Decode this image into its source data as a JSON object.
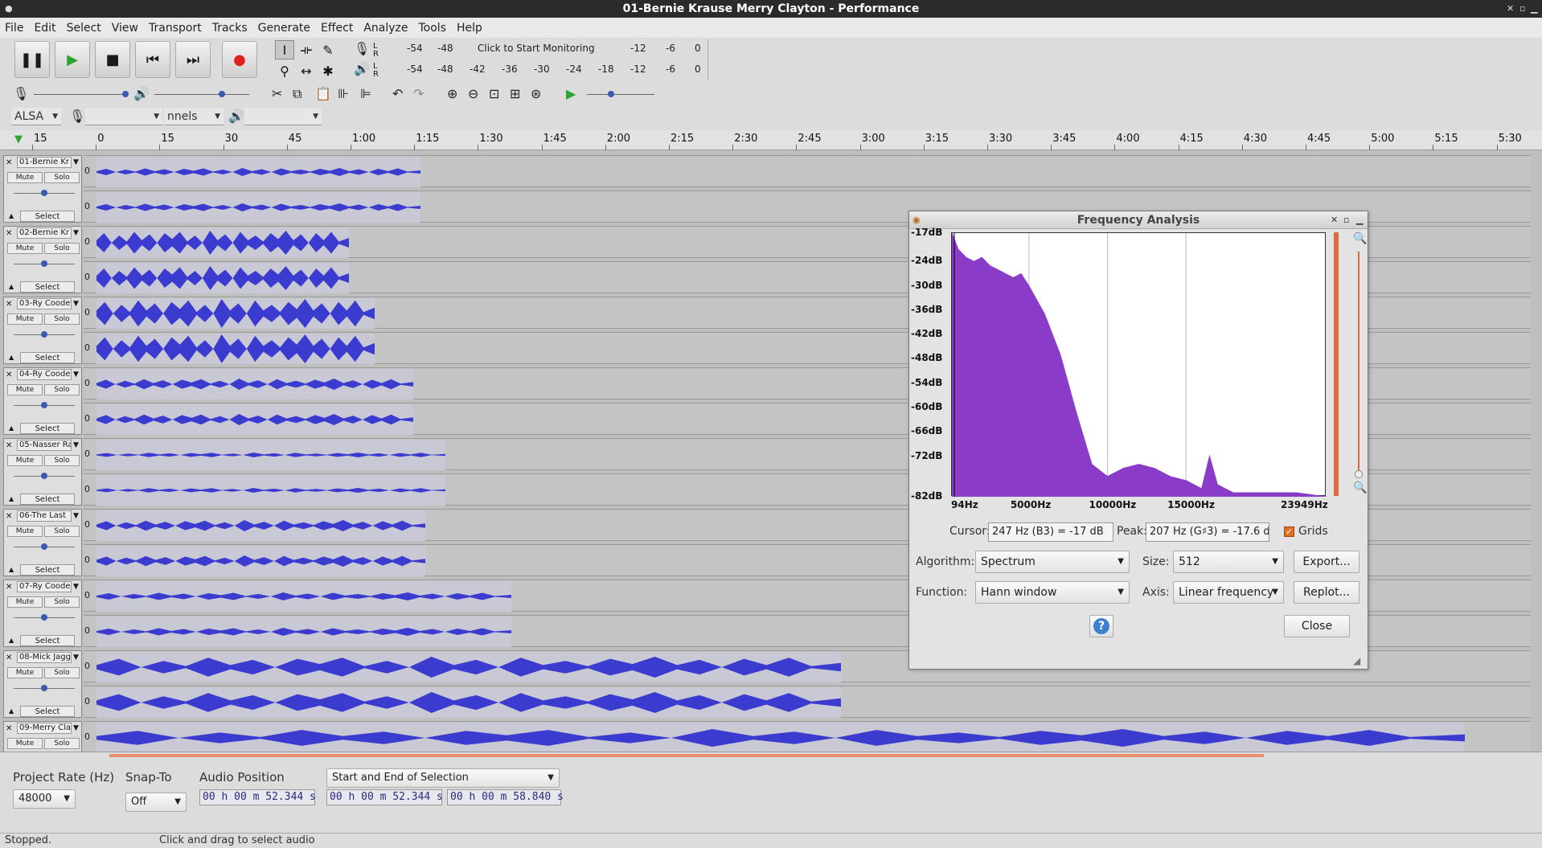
{
  "window": {
    "title": "01-Bernie Krause Merry Clayton - Performance"
  },
  "menu": [
    "File",
    "Edit",
    "Select",
    "View",
    "Transport",
    "Tracks",
    "Generate",
    "Effect",
    "Analyze",
    "Tools",
    "Help"
  ],
  "meter": {
    "record_scale": [
      "-54",
      "-48",
      "Click to Start Monitoring",
      "-12",
      "-6",
      "0"
    ],
    "play_scale": [
      "-54",
      "-48",
      "-42",
      "-36",
      "-30",
      "-24",
      "-18",
      "-12",
      "-6",
      "0"
    ],
    "lr": [
      "L",
      "R"
    ]
  },
  "device": {
    "host": "ALSA",
    "channels": "nnels"
  },
  "ruler": [
    "15",
    "0",
    "15",
    "30",
    "45",
    "1:00",
    "1:15",
    "1:30",
    "1:45",
    "2:00",
    "2:15",
    "2:30",
    "2:45",
    "3:00",
    "3:15",
    "3:30",
    "3:45",
    "4:00",
    "4:15",
    "4:30",
    "4:45",
    "5:00",
    "5:15",
    "5:30"
  ],
  "track_buttons": {
    "mute": "Mute",
    "solo": "Solo",
    "select": "Select",
    "zero": "0"
  },
  "tracks": [
    {
      "name": "01-Bernie Kr",
      "length": 0.225
    },
    {
      "name": "02-Bernie Kr",
      "length": 0.175
    },
    {
      "name": "03-Ry Coode",
      "length": 0.193
    },
    {
      "name": "04-Ry Coode",
      "length": 0.22
    },
    {
      "name": "05-Nasser Ra",
      "length": 0.242
    },
    {
      "name": "06-The Last",
      "length": 0.228
    },
    {
      "name": "07-Ry Coode",
      "length": 0.288
    },
    {
      "name": "08-Mick Jagg",
      "length": 0.517
    },
    {
      "name": "09-Merry Cla",
      "length": 0.95
    }
  ],
  "dialog": {
    "title": "Frequency Analysis",
    "db_labels": [
      "-17dB",
      "-24dB",
      "-30dB",
      "-36dB",
      "-42dB",
      "-48dB",
      "-54dB",
      "-60dB",
      "-66dB",
      "-72dB",
      "-82dB"
    ],
    "hz_labels": [
      "94Hz",
      "5000Hz",
      "10000Hz",
      "15000Hz",
      "23949Hz"
    ],
    "cursor_label": "Cursor:",
    "cursor_value": "247 Hz (B3) = -17 dB",
    "peak_label": "Peak:",
    "peak_value": "207 Hz (G♯3) = -17.6 d",
    "grids_label": "Grids",
    "grids_checked": true,
    "algorithm_label": "Algorithm:",
    "algorithm": "Spectrum",
    "size_label": "Size:",
    "size": "512",
    "function_label": "Function:",
    "function": "Hann window",
    "axis_label": "Axis:",
    "axis": "Linear frequency",
    "export": "Export...",
    "replot": "Replot...",
    "help": "?",
    "close": "Close"
  },
  "chart_data": {
    "type": "area",
    "xlabel": "",
    "ylabel": "",
    "xlim": [
      94,
      23949
    ],
    "ylim": [
      -82,
      -17
    ],
    "x_ticks": [
      "94Hz",
      "5000Hz",
      "10000Hz",
      "15000Hz",
      "23949Hz"
    ],
    "y_ticks": [
      "-17dB",
      "-24dB",
      "-30dB",
      "-36dB",
      "-42dB",
      "-48dB",
      "-54dB",
      "-60dB",
      "-66dB",
      "-72dB",
      "-82dB"
    ],
    "grid": true,
    "color": "#8a3cc8",
    "x": [
      94,
      500,
      1000,
      1500,
      2000,
      2500,
      3000,
      3500,
      4000,
      4500,
      5000,
      6000,
      7000,
      8000,
      9000,
      10000,
      11000,
      12000,
      13000,
      14000,
      15000,
      16000,
      16500,
      17000,
      18000,
      20000,
      22000,
      23949
    ],
    "y": [
      -17,
      -21,
      -23,
      -24,
      -23,
      -25,
      -26,
      -27,
      -28,
      -27,
      -30,
      -37,
      -47,
      -61,
      -74,
      -77,
      -75,
      -74,
      -75,
      -77,
      -78,
      -80,
      -72,
      -79,
      -81,
      -81,
      -81,
      -82
    ]
  },
  "bottom": {
    "project_rate_label": "Project Rate (Hz)",
    "project_rate": "48000",
    "snap_label": "Snap-To",
    "snap": "Off",
    "audio_pos_label": "Audio Position",
    "audio_pos": "00 h 00 m 52.344 s",
    "selection_mode": "Start and End of Selection",
    "sel_start": "00 h 00 m 52.344 s",
    "sel_end": "00 h 00 m 58.840 s"
  },
  "status": {
    "left": "Stopped.",
    "hint": "Click and drag to select audio"
  }
}
